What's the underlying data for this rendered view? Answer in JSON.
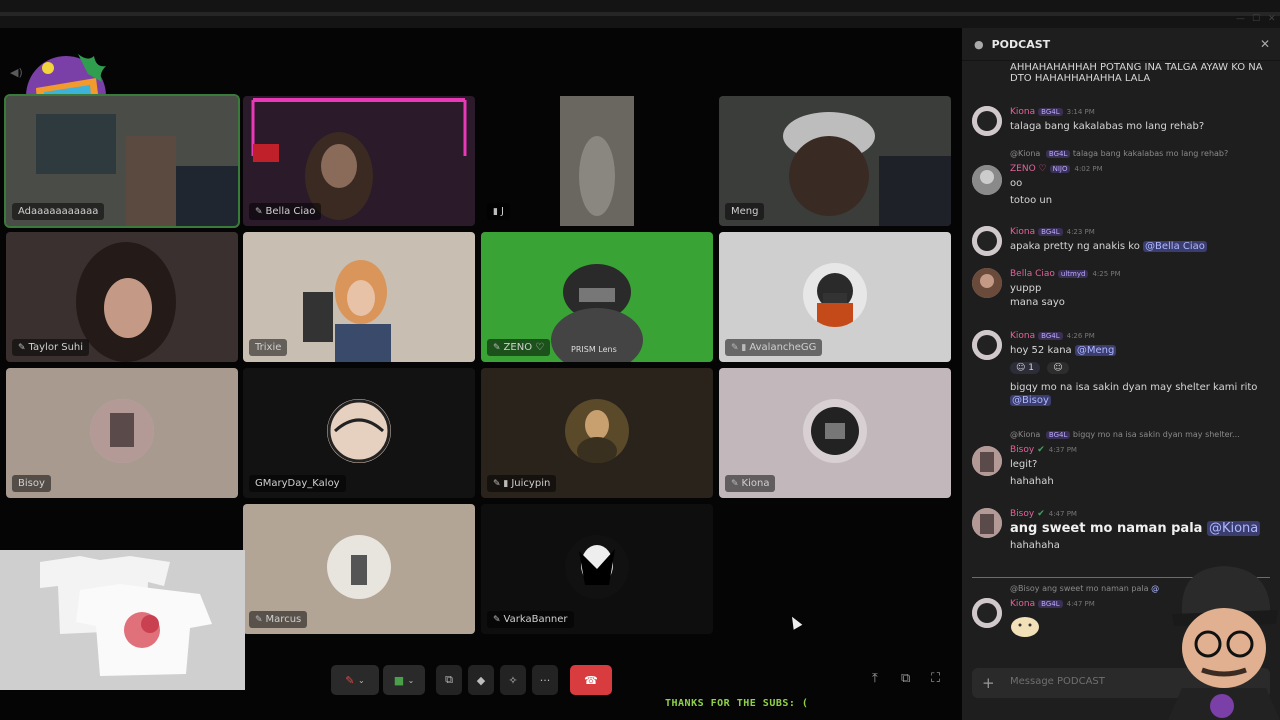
{
  "channel": {
    "name": "PODCAST"
  },
  "tiles": [
    {
      "name": "Adaaaaaaaaaaa",
      "mic": "",
      "speaking": true
    },
    {
      "name": "Bella Ciao",
      "mic": "muted"
    },
    {
      "name": "J",
      "mic": "mobile"
    },
    {
      "name": "Meng",
      "mic": ""
    },
    {
      "name": "Taylor Suhi",
      "mic": "muted"
    },
    {
      "name": "Trixie",
      "mic": ""
    },
    {
      "name": "ZENO ♡",
      "mic": "muted"
    },
    {
      "name": "AvalancheGG",
      "mic": "muted-mobile"
    },
    {
      "name": "Bisoy",
      "mic": ""
    },
    {
      "name": "GMaryDay_Kaloy",
      "mic": ""
    },
    {
      "name": "Juicypin",
      "mic": "muted-mobile"
    },
    {
      "name": "Kiona",
      "mic": "muted"
    },
    {
      "name": "Marcus",
      "mic": "muted"
    },
    {
      "name": "VarkaBanner",
      "mic": "muted"
    }
  ],
  "overlay": {
    "prism_watermark": "PRISM Lens"
  },
  "subs_ticker": "THANKS FOR THE SUBS: (",
  "chat": {
    "top_line": "AHHAHAHAHHAH POTANG INA TALGA AYAW KO NA DTO HAHAHHAHAHHA LALA",
    "messages": [
      {
        "user": "Kiona",
        "tag": "BG4L",
        "time": "3:14 PM",
        "text": "talaga bang kakalabas mo lang rehab?"
      },
      {
        "reply_user": "@Kiona",
        "reply_tag": "BG4L",
        "reply_text": "talaga bang kakalabas mo lang rehab?",
        "user": "ZENO ♡",
        "tag": "NIJO",
        "time": "4:02 PM",
        "text": "oo",
        "text2": "totoo un"
      },
      {
        "user": "Kiona",
        "tag": "BG4L",
        "time": "4:23 PM",
        "text": "apaka pretty ng anakis ko",
        "mention": "@Bella Ciao"
      },
      {
        "user": "Bella Ciao",
        "tag": "ultmyd",
        "time": "4:25 PM",
        "text": "yuppp",
        "text2": "mana sayo"
      },
      {
        "user": "Kiona",
        "tag": "BG4L",
        "time": "4:26 PM",
        "text": "hoy 52 kana",
        "mention": "@Meng",
        "reaction_count": "1",
        "text2": "bigqy mo na isa sakin dyan may shelter kami rito",
        "mention2": "@Bisoy"
      },
      {
        "reply_user": "@Kiona",
        "reply_tag": "BG4L",
        "reply_text": "bigqy mo na isa sakin dyan may shelter...",
        "user": "Bisoy",
        "tag": "",
        "time": "4:37 PM",
        "text": "legit?",
        "text2": "hahahah"
      },
      {
        "user": "Bisoy",
        "tag": "",
        "time": "4:47 PM",
        "text": "ang sweet mo naman pala",
        "mention": "@Kiona",
        "text2": "hahahaha"
      },
      {
        "reply_user": "@Bisoy",
        "reply_text": "ang sweet mo naman pala",
        "reply_mention": "@",
        "user": "Kiona",
        "tag": "BG4L",
        "time": "4:47 PM"
      }
    ],
    "compose_placeholder": "Message PODCAST"
  },
  "colors": {
    "accent_green": "#8fd24a",
    "hangup": "#d83c3e",
    "username_pink": "#e0649b",
    "mention_bg": "#3a3d6e"
  }
}
